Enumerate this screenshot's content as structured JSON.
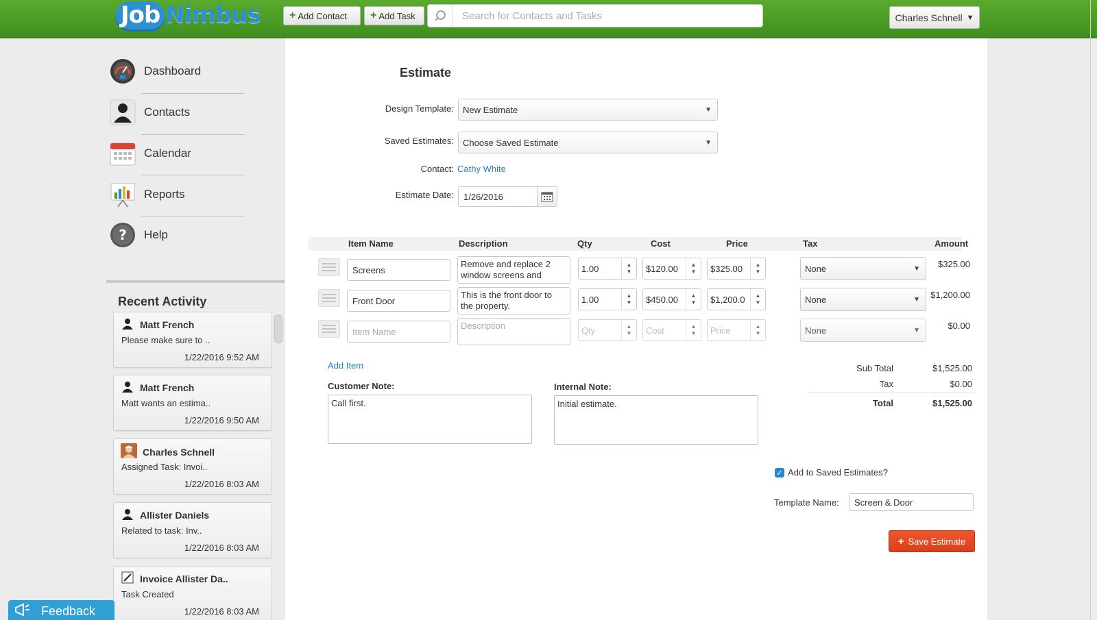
{
  "header": {
    "logo_left": "Job",
    "logo_right": "Nimbus",
    "add_contact": "Add Contact",
    "add_task": "Add Task",
    "search_placeholder": "Search for Contacts and Tasks",
    "user_name": "Charles Schnell"
  },
  "sidebar": {
    "items": [
      {
        "label": "Dashboard",
        "icon": "dashboard-gauge-icon"
      },
      {
        "label": "Contacts",
        "icon": "person-icon"
      },
      {
        "label": "Calendar",
        "icon": "calendar-icon"
      },
      {
        "label": "Reports",
        "icon": "bar-chart-icon"
      },
      {
        "label": "Help",
        "icon": "help-question-icon"
      }
    ],
    "recent_title": "Recent Activity",
    "activity": [
      {
        "who": "Matt French",
        "msg": "Please make sure to ..",
        "when": "1/22/2016 9:52 AM"
      },
      {
        "who": "Matt French",
        "msg": "Matt wants an estima..",
        "when": "1/22/2016 9:50 AM"
      },
      {
        "who": "Charles Schnell",
        "msg": "Assigned Task: Invoi..",
        "when": "1/22/2016 8:03 AM"
      },
      {
        "who": "Allister Daniels",
        "msg": "Related to task: Inv..",
        "when": "1/22/2016 8:03 AM"
      },
      {
        "who": "Invoice Allister Da..",
        "msg": "Task Created",
        "when": "1/22/2016 8:03 AM"
      }
    ],
    "feedback": "Feedback"
  },
  "estimate": {
    "title": "Estimate",
    "design_template_label": "Design Template:",
    "design_template_value": "New Estimate",
    "saved_estimates_label": "Saved Estimates:",
    "saved_estimates_value": "Choose Saved Estimate",
    "contact_label": "Contact:",
    "contact_value": "Cathy White",
    "date_label": "Estimate Date:",
    "date_value": "1/26/2016"
  },
  "table": {
    "headers": {
      "item_name": "Item Name",
      "description": "Description",
      "qty": "Qty",
      "cost": "Cost",
      "price": "Price",
      "tax": "Tax",
      "amount": "Amount"
    },
    "rows": [
      {
        "name": "Screens",
        "description": "Remove and replace 2 window screens and",
        "qty": "1.00",
        "cost": "$120.00",
        "price": "$325.00",
        "tax": "None",
        "amount": "$325.00"
      },
      {
        "name": "Front Door",
        "description": "This is the front door to the property.",
        "qty": "1.00",
        "cost": "$450.00",
        "price": "$1,200.0",
        "tax": "None",
        "amount": "$1,200.00"
      }
    ],
    "new_row": {
      "name_placeholder": "Item Name",
      "description_placeholder": "Description",
      "qty_placeholder": "Qty",
      "cost_placeholder": "Cost",
      "price_placeholder": "Price",
      "tax": "None",
      "amount": "$0.00"
    },
    "add_item": "Add Item"
  },
  "totals": {
    "subtotal_label": "Sub Total",
    "subtotal_value": "$1,525.00",
    "tax_label": "Tax",
    "tax_value": "$0.00",
    "total_label": "Total",
    "total_value": "$1,525.00"
  },
  "notes": {
    "customer_label": "Customer Note:",
    "customer_value": "Call first.",
    "internal_label": "Internal Note:",
    "internal_value": "Initial estimate."
  },
  "save": {
    "add_to_saved_label": "Add to Saved Estimates?",
    "add_to_saved_checked": true,
    "template_name_label": "Template Name:",
    "template_name_value": "Screen & Door",
    "save_button": "Save Estimate"
  },
  "colors": {
    "header_green": "#4c9e28",
    "link_blue": "#2b7fc6",
    "save_orange": "#e54b24",
    "feedback_blue": "#2f9fd6"
  }
}
